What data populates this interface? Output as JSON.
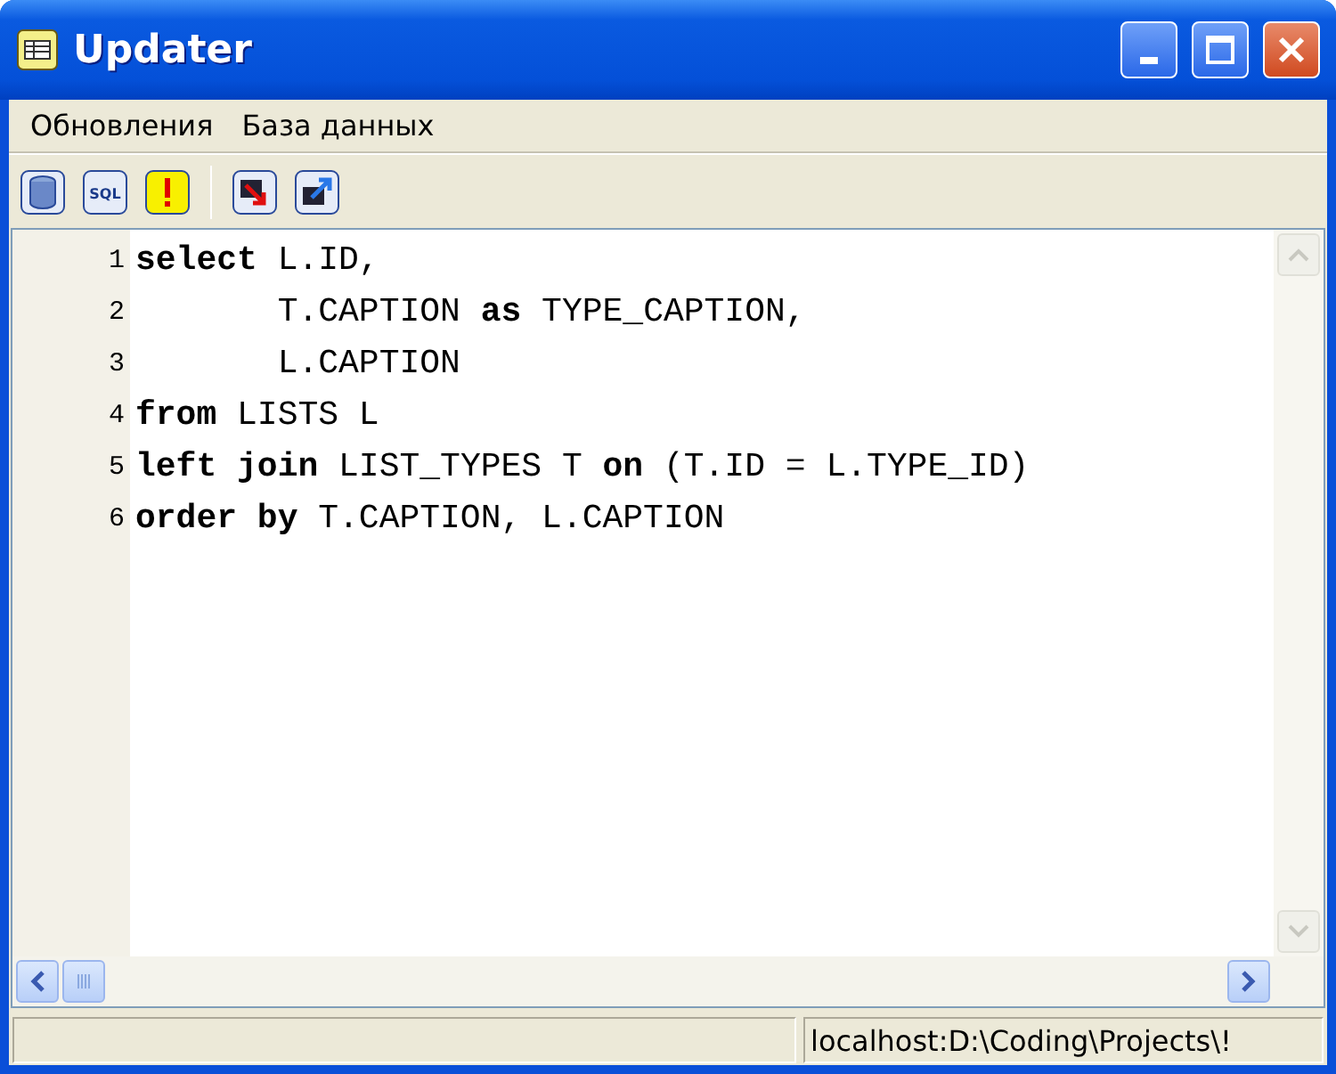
{
  "window": {
    "title": "Updater"
  },
  "menu": [
    {
      "label": "Обновления"
    },
    {
      "label": "База данных"
    }
  ],
  "toolbar": [
    {
      "kind": "database"
    },
    {
      "kind": "sql",
      "label": "SQL"
    },
    {
      "kind": "warning"
    },
    {
      "kind": "separator"
    },
    {
      "kind": "import"
    },
    {
      "kind": "export"
    }
  ],
  "editor": {
    "lines": [
      {
        "number": "1",
        "tokens": [
          {
            "text": "select",
            "kind": "keyword"
          },
          {
            "text": " L.ID,",
            "kind": "plain"
          }
        ]
      },
      {
        "number": "2",
        "tokens": [
          {
            "text": "       T.CAPTION ",
            "kind": "plain"
          },
          {
            "text": "as",
            "kind": "keyword"
          },
          {
            "text": " TYPE_CAPTION,",
            "kind": "plain"
          }
        ]
      },
      {
        "number": "3",
        "tokens": [
          {
            "text": "       L.CAPTION",
            "kind": "plain"
          }
        ]
      },
      {
        "number": "4",
        "tokens": [
          {
            "text": "from",
            "kind": "keyword"
          },
          {
            "text": " LISTS L",
            "kind": "plain"
          }
        ]
      },
      {
        "number": "5",
        "tokens": [
          {
            "text": "left join",
            "kind": "keyword"
          },
          {
            "text": " LIST_TYPES T ",
            "kind": "plain"
          },
          {
            "text": "on",
            "kind": "keyword"
          },
          {
            "text": " (T.ID = L.TYPE_ID)",
            "kind": "plain"
          }
        ]
      },
      {
        "number": "6",
        "tokens": [
          {
            "text": "order by",
            "kind": "keyword"
          },
          {
            "text": " T.CAPTION, L.CAPTION",
            "kind": "plain"
          }
        ]
      }
    ]
  },
  "status_bar": {
    "panels": [
      {
        "kind": "blank"
      },
      {
        "kind": "text",
        "text": "localhost:D:\\Coding\\Projects\\!"
      }
    ]
  }
}
